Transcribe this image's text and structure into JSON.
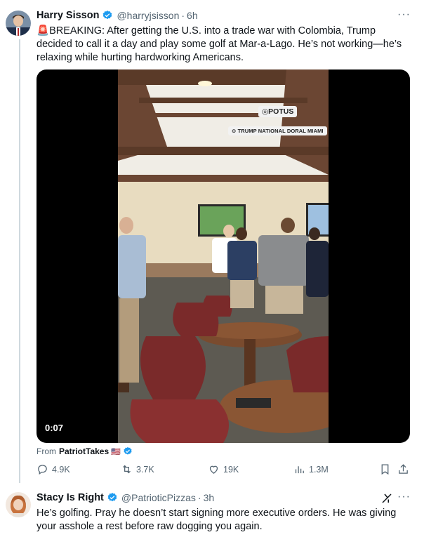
{
  "tweet1": {
    "author_name": "Harry Sisson",
    "handle": "@harryjsisson",
    "time": "6h",
    "alert_emoji": "🚨",
    "text": "BREAKING: After getting the U.S. into a trade war with Colombia, Trump decided to call it a day and play some golf at Mar-a-Lago. He’s not working—he’s relaxing while hurting hardworking Americans.",
    "video": {
      "duration": "0:07",
      "overlay_tag": "POTUS",
      "overlay_location": "TRUMP NATIONAL DORAL MIAMI"
    },
    "from_label": "From",
    "from_source": "PatriotTakes",
    "from_flag": "🇺🇸",
    "actions": {
      "replies": "4.9K",
      "reposts": "3.7K",
      "likes": "19K",
      "views": "1.3M"
    }
  },
  "tweet2": {
    "author_name": "Stacy Is Right",
    "handle": "@PatrioticPizzas",
    "time": "3h",
    "text": "He’s golfing. Pray he doesn’t start signing more executive orders. He was giving your asshole a rest before raw dogging you again."
  },
  "colors": {
    "verified": "#1d9bf0",
    "secondary_text": "#536471",
    "primary_text": "#0f1419",
    "thread_line": "#cfd9de"
  },
  "icons": [
    "verified-badge-icon",
    "more-icon",
    "reply-icon",
    "repost-icon",
    "like-icon",
    "views-icon",
    "bookmark-icon",
    "share-icon",
    "grok-icon",
    "location-pin-icon",
    "instagram-icon"
  ]
}
